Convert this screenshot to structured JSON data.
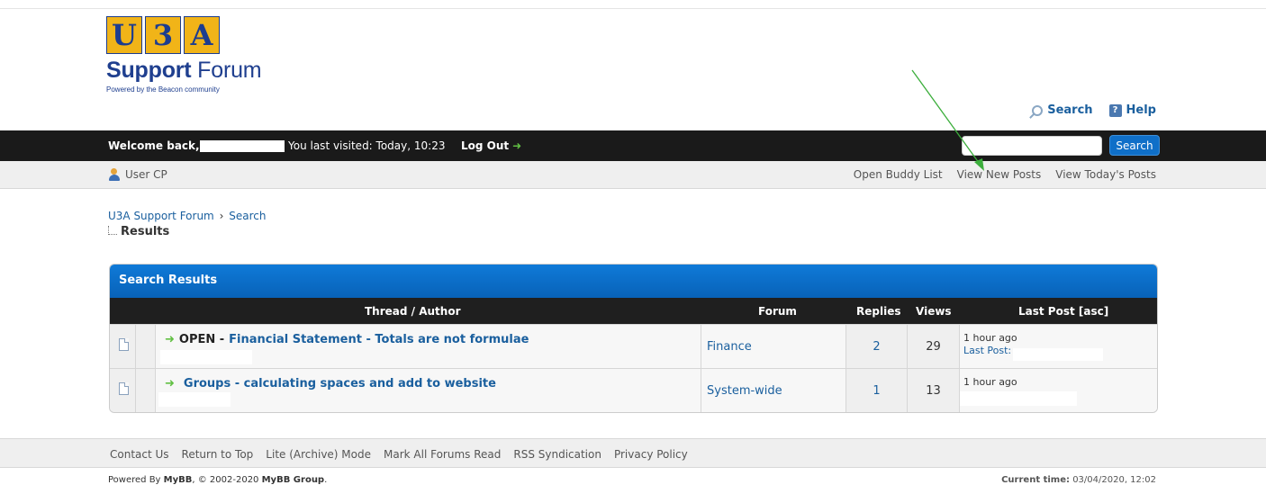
{
  "logo": {
    "blocks": [
      "U",
      "3",
      "A"
    ],
    "title_bold": "Support",
    "title_rest": " Forum",
    "subtitle": "Powered by the Beacon community"
  },
  "toplinks": {
    "search": "Search",
    "help": "Help"
  },
  "header": {
    "welcome": "Welcome back,",
    "last_visited": "You last visited: Today, 10:23",
    "logout": "Log Out",
    "search_button": "Search",
    "search_placeholder": ""
  },
  "subnav": {
    "user_cp": "User CP",
    "buddy": "Open Buddy List",
    "new_posts": "View New Posts",
    "today_posts": "View Today's Posts"
  },
  "breadcrumb": {
    "root": "U3A Support Forum",
    "sep": "›",
    "search": "Search",
    "current": "Results"
  },
  "results": {
    "title": "Search Results",
    "columns": {
      "thread": "Thread / Author",
      "forum": "Forum",
      "replies": "Replies",
      "views": "Views",
      "lastpost": "Last Post [asc]"
    },
    "rows": [
      {
        "prefix": "OPEN -",
        "title": "Financial Statement - Totals are not formulae",
        "forum": "Finance",
        "replies": "2",
        "views": "29",
        "time": "1 hour ago",
        "lastpost_label": "Last Post:"
      },
      {
        "prefix": "",
        "title": "Groups - calculating spaces and add to website",
        "forum": "System-wide",
        "replies": "1",
        "views": "13",
        "time": "1 hour ago",
        "lastpost_label": ""
      }
    ]
  },
  "footer": {
    "links": [
      "Contact Us",
      "Return to Top",
      "Lite (Archive) Mode",
      "Mark All Forums Read",
      "RSS Syndication",
      "Privacy Policy"
    ],
    "powered_pre": "Powered By ",
    "powered_brand": "MyBB",
    "powered_mid": ", © 2002-2020 ",
    "powered_group": "MyBB Group",
    "powered_end": ".",
    "current_time_label": "Current time:",
    "current_time": "03/04/2020, 12:02"
  },
  "colors": {
    "accent_blue": "#0f6fc8",
    "dark_bar": "#1a1a1a",
    "link": "#1a5f9e",
    "annotation_arrow": "#3cae3c"
  }
}
